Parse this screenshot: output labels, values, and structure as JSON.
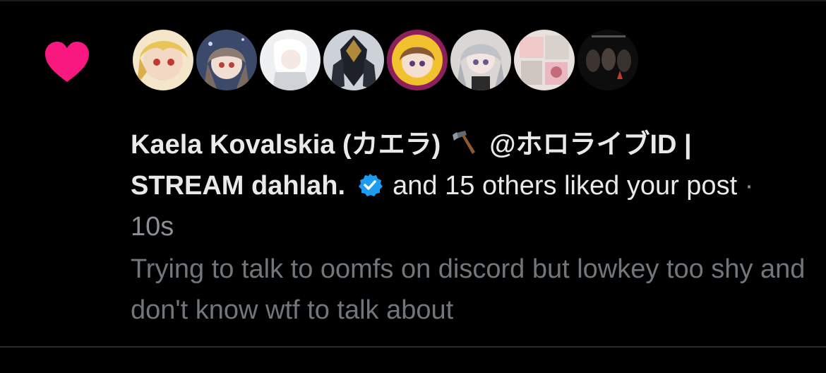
{
  "notification": {
    "type_icon": "heart-icon",
    "heart_color": "#f91880",
    "avatars": [
      {
        "icon": "avatar-anime-blonde"
      },
      {
        "icon": "avatar-anime-brown-hair"
      },
      {
        "icon": "avatar-anime-white-hair"
      },
      {
        "icon": "avatar-armored-knight"
      },
      {
        "icon": "avatar-anime-yellow-ring"
      },
      {
        "icon": "avatar-anime-silver-hair"
      },
      {
        "icon": "avatar-collage"
      },
      {
        "icon": "avatar-dark-photo"
      }
    ],
    "actor_name": "Kaela Kovalskia (カエラ)",
    "actor_emoji_icon": "hammer-icon",
    "actor_suffix": "@ホロライブID | STREAM dahlah.",
    "verified_icon": "verified-badge-icon",
    "verified_color": "#1d9bf0",
    "action_text": "and 15 others liked your post",
    "separator": "·",
    "timestamp": "10s",
    "post_text": "Trying to talk to oomfs on discord but lowkey too shy and don't know wtf to talk about"
  }
}
